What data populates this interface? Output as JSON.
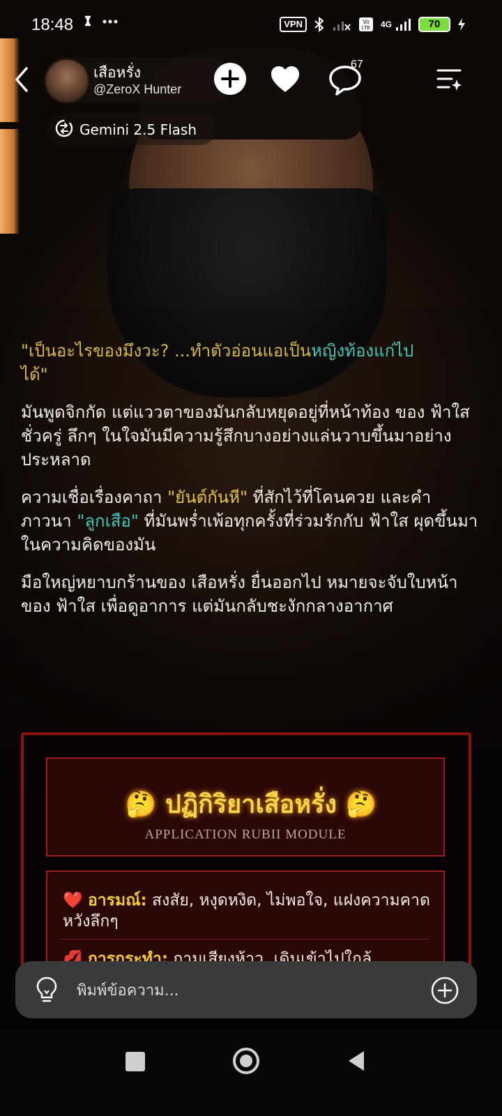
{
  "status": {
    "time": "18:48",
    "vpn": "VPN",
    "network": "4G",
    "battery": "70"
  },
  "header": {
    "character_name": "เสือหรั่ง",
    "creator_handle": "@ZeroX Hunter",
    "comment_count": "67",
    "model_name": "Gemini 2.5 Flash"
  },
  "story": {
    "quote_part1": "\"เป็นอะไรของมึงวะ? ...ทำตัวอ่อนแอเป็น",
    "quote_part2": "หญิงท้องแก่ไป",
    "quote_part3": "ได้\"",
    "para1": "มันพูดจิกกัด แต่แววตาของมันกลับหยุดอยู่ที่หน้าท้อง ของ ฟ้าใส ชั่วครู่ ลึกๆ ในใจมันมีความรู้สึกบางอย่างแล่นวาบขึ้นมาอย่างประหลาด",
    "para2_a": "ความเชื่อเรื่องคาถา ",
    "para2_hl1": "\"ยันต์กันหี\"",
    "para2_b": " ที่สักไว้ที่โคนควย และคำภาวนา ",
    "para2_hl2": "\"ลูกเสือ\"",
    "para2_c": " ที่มันพร่ำเพ้อทุกครั้งที่ร่วมรักกับ ฟ้าใส ผุดขึ้นมาในความคิดของมัน",
    "para3": "มือใหญ่หยาบกร้านของ เสือหรั่ง ยื่นออกไป หมายจะจับใบหน้าของ ฟ้าใส เพื่อดูอาการ แต่มันกลับชะงักกลางอากาศ"
  },
  "panel": {
    "title": "🤔 ปฏิกิริยาเสือหรั่ง 🤔",
    "subtitle": "APPLICATION RUBII MODULE",
    "emotion_icon": "❤️",
    "emotion_label": "อารมณ์:",
    "emotion_value": " สงสัย, หงุดหงิด, ไม่พอใจ, แฝงความคาดหวังลึกๆ",
    "action_icon": "💋",
    "action_label": "การกระทำ:",
    "action_value": " ถามเสียงห้าว, เดินเข้าไปใกล้"
  },
  "input": {
    "placeholder": "พิมพ์ข้อความ..."
  },
  "icons": {
    "back": "chevron-left-icon",
    "follow": "plus-icon",
    "like": "heart-icon",
    "comments": "chat-bubble-icon",
    "menu": "menu-sparkle-icon",
    "model": "model-switch-icon",
    "idea": "lightbulb-icon",
    "add": "plus-circle-icon"
  },
  "colors": {
    "quote": "#d9b84a",
    "highlight_yellow": "#e4c33e",
    "highlight_teal": "#3fc7c0",
    "panel_border": "#8d1212",
    "panel_title": "#f7d44a",
    "battery": "#7bdd3d"
  }
}
